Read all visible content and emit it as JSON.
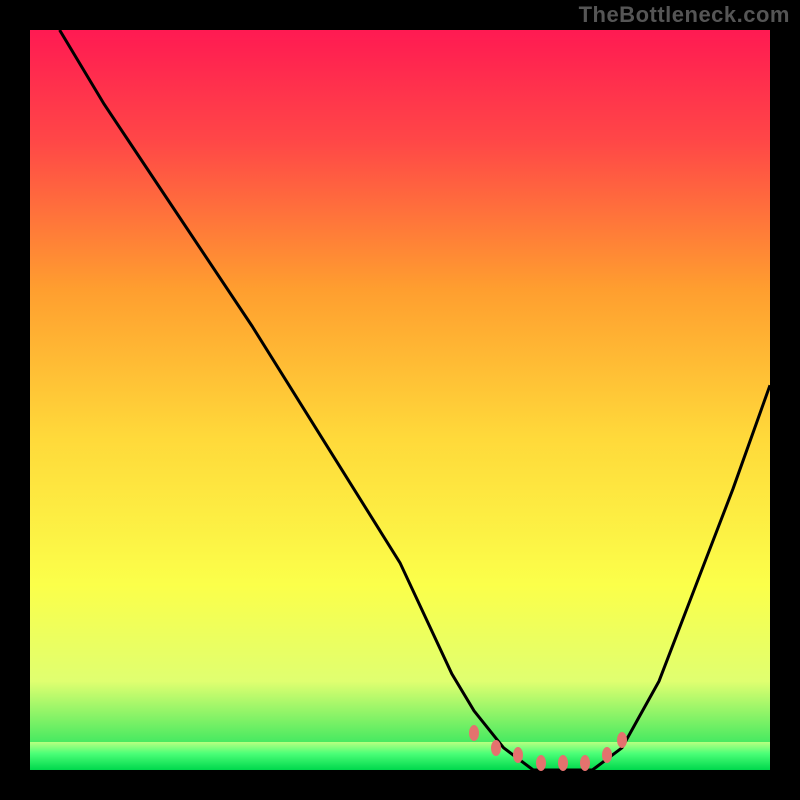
{
  "watermark": "TheBottleneck.com",
  "chart_data": {
    "type": "line",
    "title": "",
    "xlabel": "",
    "ylabel": "",
    "xlim": [
      0,
      100
    ],
    "ylim": [
      0,
      100
    ],
    "series": [
      {
        "name": "curve",
        "x": [
          4,
          10,
          20,
          30,
          40,
          50,
          57,
          60,
          64,
          68,
          72,
          76,
          80,
          85,
          90,
          95,
          100
        ],
        "values": [
          100,
          90,
          75,
          60,
          44,
          28,
          13,
          8,
          3,
          0,
          0,
          0,
          3,
          12,
          25,
          38,
          52
        ]
      }
    ],
    "markers": {
      "name": "highlight-band",
      "x": [
        60,
        63,
        66,
        69,
        72,
        75,
        78,
        80
      ],
      "values": [
        5,
        3,
        2,
        1,
        1,
        1,
        2,
        4
      ]
    },
    "gradient_stops": [
      {
        "offset": 0,
        "color": "#ff1a52"
      },
      {
        "offset": 15,
        "color": "#ff4747"
      },
      {
        "offset": 35,
        "color": "#ff9e2f"
      },
      {
        "offset": 55,
        "color": "#ffd93a"
      },
      {
        "offset": 75,
        "color": "#fbff4a"
      },
      {
        "offset": 88,
        "color": "#e0ff70"
      },
      {
        "offset": 100,
        "color": "#00e05a"
      }
    ]
  }
}
